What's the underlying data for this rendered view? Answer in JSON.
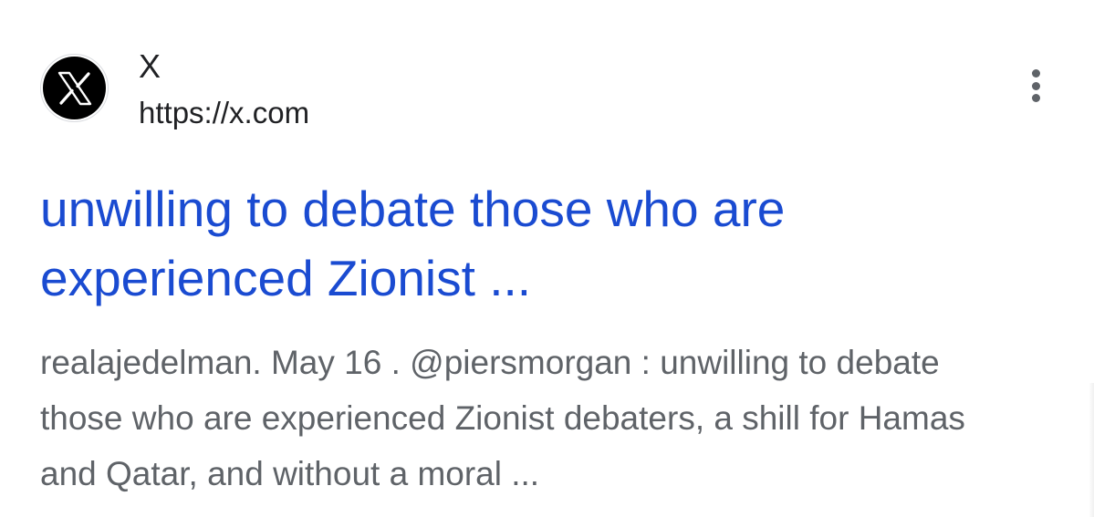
{
  "result": {
    "site": {
      "name": "X",
      "url": "https://x.com",
      "favicon_icon": "x-logo-icon"
    },
    "more_options_icon": "more-vert-icon",
    "title": "unwilling to debate those who are experienced Zionist ...",
    "snippet": "realajedelman. May 16 . @piersmorgan : unwilling to debate those who are experienced Zionist debaters, a shill for Hamas and Qatar, and without a moral ..."
  },
  "colors": {
    "title_link": "#1a4bd1",
    "snippet_text": "#5f6368",
    "primary_text": "#202124",
    "background": "#ffffff"
  }
}
